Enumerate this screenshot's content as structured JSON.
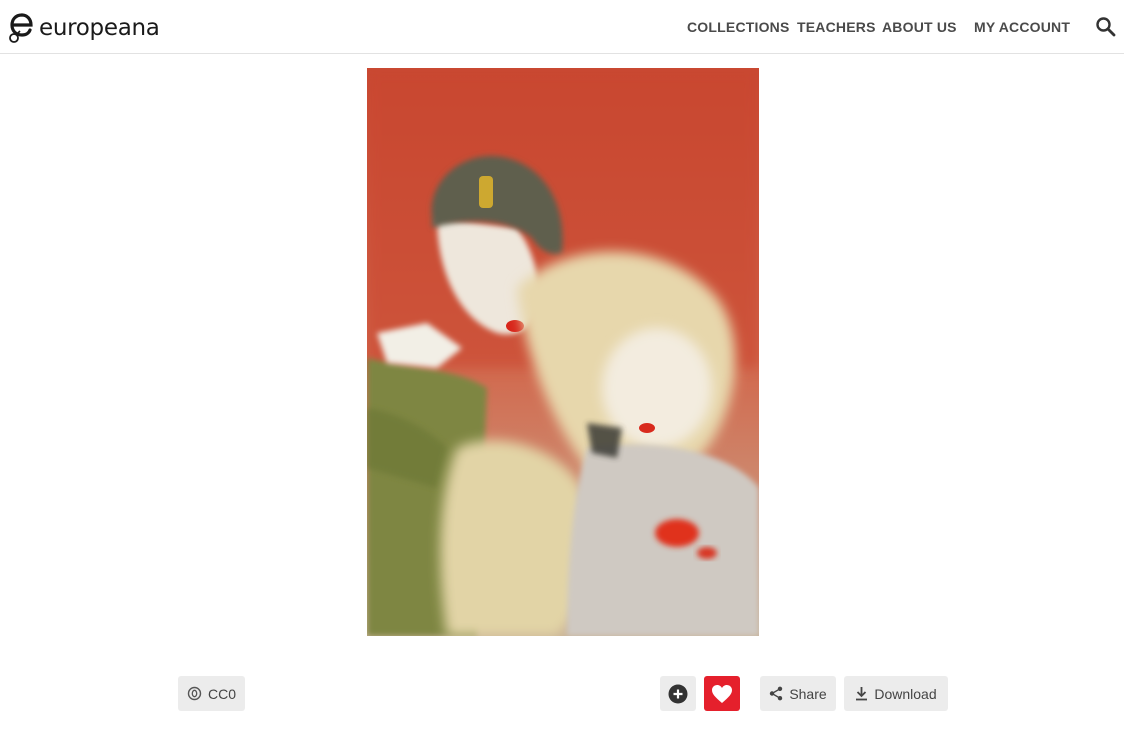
{
  "brand": {
    "name": "europeana"
  },
  "nav": {
    "items": [
      {
        "label": "COLLECTIONS"
      },
      {
        "label": "TEACHERS"
      },
      {
        "label": "ABOUT US"
      },
      {
        "label": "MY ACCOUNT"
      }
    ],
    "search_icon": "magnifier-icon"
  },
  "artwork": {
    "description_icon": "painting-image"
  },
  "actions": {
    "license_label": "CC0",
    "license_icon": "public-domain-icon",
    "add_icon": "plus-circle-icon",
    "like_icon": "heart-icon",
    "share_label": "Share",
    "share_icon": "share-icon",
    "download_label": "Download",
    "download_icon": "download-arrow-icon"
  },
  "colors": {
    "like_button": "#e5202c",
    "button_bg": "#ececec",
    "nav_text": "#4a4a4a"
  }
}
